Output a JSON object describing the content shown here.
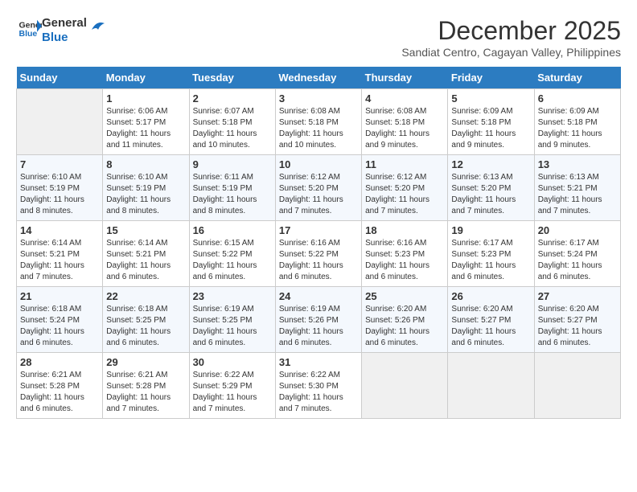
{
  "header": {
    "logo_line1": "General",
    "logo_line2": "Blue",
    "month_title": "December 2025",
    "subtitle": "Sandiat Centro, Cagayan Valley, Philippines"
  },
  "weekdays": [
    "Sunday",
    "Monday",
    "Tuesday",
    "Wednesday",
    "Thursday",
    "Friday",
    "Saturday"
  ],
  "weeks": [
    [
      {
        "day": "",
        "sunrise": "",
        "sunset": "",
        "daylight": "",
        "empty": true
      },
      {
        "day": "1",
        "sunrise": "6:06 AM",
        "sunset": "5:17 PM",
        "daylight": "11 hours and 11 minutes."
      },
      {
        "day": "2",
        "sunrise": "6:07 AM",
        "sunset": "5:18 PM",
        "daylight": "11 hours and 10 minutes."
      },
      {
        "day": "3",
        "sunrise": "6:08 AM",
        "sunset": "5:18 PM",
        "daylight": "11 hours and 10 minutes."
      },
      {
        "day": "4",
        "sunrise": "6:08 AM",
        "sunset": "5:18 PM",
        "daylight": "11 hours and 9 minutes."
      },
      {
        "day": "5",
        "sunrise": "6:09 AM",
        "sunset": "5:18 PM",
        "daylight": "11 hours and 9 minutes."
      },
      {
        "day": "6",
        "sunrise": "6:09 AM",
        "sunset": "5:18 PM",
        "daylight": "11 hours and 9 minutes."
      }
    ],
    [
      {
        "day": "7",
        "sunrise": "6:10 AM",
        "sunset": "5:19 PM",
        "daylight": "11 hours and 8 minutes."
      },
      {
        "day": "8",
        "sunrise": "6:10 AM",
        "sunset": "5:19 PM",
        "daylight": "11 hours and 8 minutes."
      },
      {
        "day": "9",
        "sunrise": "6:11 AM",
        "sunset": "5:19 PM",
        "daylight": "11 hours and 8 minutes."
      },
      {
        "day": "10",
        "sunrise": "6:12 AM",
        "sunset": "5:20 PM",
        "daylight": "11 hours and 7 minutes."
      },
      {
        "day": "11",
        "sunrise": "6:12 AM",
        "sunset": "5:20 PM",
        "daylight": "11 hours and 7 minutes."
      },
      {
        "day": "12",
        "sunrise": "6:13 AM",
        "sunset": "5:20 PM",
        "daylight": "11 hours and 7 minutes."
      },
      {
        "day": "13",
        "sunrise": "6:13 AM",
        "sunset": "5:21 PM",
        "daylight": "11 hours and 7 minutes."
      }
    ],
    [
      {
        "day": "14",
        "sunrise": "6:14 AM",
        "sunset": "5:21 PM",
        "daylight": "11 hours and 7 minutes."
      },
      {
        "day": "15",
        "sunrise": "6:14 AM",
        "sunset": "5:21 PM",
        "daylight": "11 hours and 6 minutes."
      },
      {
        "day": "16",
        "sunrise": "6:15 AM",
        "sunset": "5:22 PM",
        "daylight": "11 hours and 6 minutes."
      },
      {
        "day": "17",
        "sunrise": "6:16 AM",
        "sunset": "5:22 PM",
        "daylight": "11 hours and 6 minutes."
      },
      {
        "day": "18",
        "sunrise": "6:16 AM",
        "sunset": "5:23 PM",
        "daylight": "11 hours and 6 minutes."
      },
      {
        "day": "19",
        "sunrise": "6:17 AM",
        "sunset": "5:23 PM",
        "daylight": "11 hours and 6 minutes."
      },
      {
        "day": "20",
        "sunrise": "6:17 AM",
        "sunset": "5:24 PM",
        "daylight": "11 hours and 6 minutes."
      }
    ],
    [
      {
        "day": "21",
        "sunrise": "6:18 AM",
        "sunset": "5:24 PM",
        "daylight": "11 hours and 6 minutes."
      },
      {
        "day": "22",
        "sunrise": "6:18 AM",
        "sunset": "5:25 PM",
        "daylight": "11 hours and 6 minutes."
      },
      {
        "day": "23",
        "sunrise": "6:19 AM",
        "sunset": "5:25 PM",
        "daylight": "11 hours and 6 minutes."
      },
      {
        "day": "24",
        "sunrise": "6:19 AM",
        "sunset": "5:26 PM",
        "daylight": "11 hours and 6 minutes."
      },
      {
        "day": "25",
        "sunrise": "6:20 AM",
        "sunset": "5:26 PM",
        "daylight": "11 hours and 6 minutes."
      },
      {
        "day": "26",
        "sunrise": "6:20 AM",
        "sunset": "5:27 PM",
        "daylight": "11 hours and 6 minutes."
      },
      {
        "day": "27",
        "sunrise": "6:20 AM",
        "sunset": "5:27 PM",
        "daylight": "11 hours and 6 minutes."
      }
    ],
    [
      {
        "day": "28",
        "sunrise": "6:21 AM",
        "sunset": "5:28 PM",
        "daylight": "11 hours and 6 minutes."
      },
      {
        "day": "29",
        "sunrise": "6:21 AM",
        "sunset": "5:28 PM",
        "daylight": "11 hours and 7 minutes."
      },
      {
        "day": "30",
        "sunrise": "6:22 AM",
        "sunset": "5:29 PM",
        "daylight": "11 hours and 7 minutes."
      },
      {
        "day": "31",
        "sunrise": "6:22 AM",
        "sunset": "5:30 PM",
        "daylight": "11 hours and 7 minutes."
      },
      {
        "day": "",
        "sunrise": "",
        "sunset": "",
        "daylight": "",
        "empty": true
      },
      {
        "day": "",
        "sunrise": "",
        "sunset": "",
        "daylight": "",
        "empty": true
      },
      {
        "day": "",
        "sunrise": "",
        "sunset": "",
        "daylight": "",
        "empty": true
      }
    ]
  ],
  "labels": {
    "sunrise_prefix": "Sunrise: ",
    "sunset_prefix": "Sunset: ",
    "daylight_prefix": "Daylight: "
  }
}
